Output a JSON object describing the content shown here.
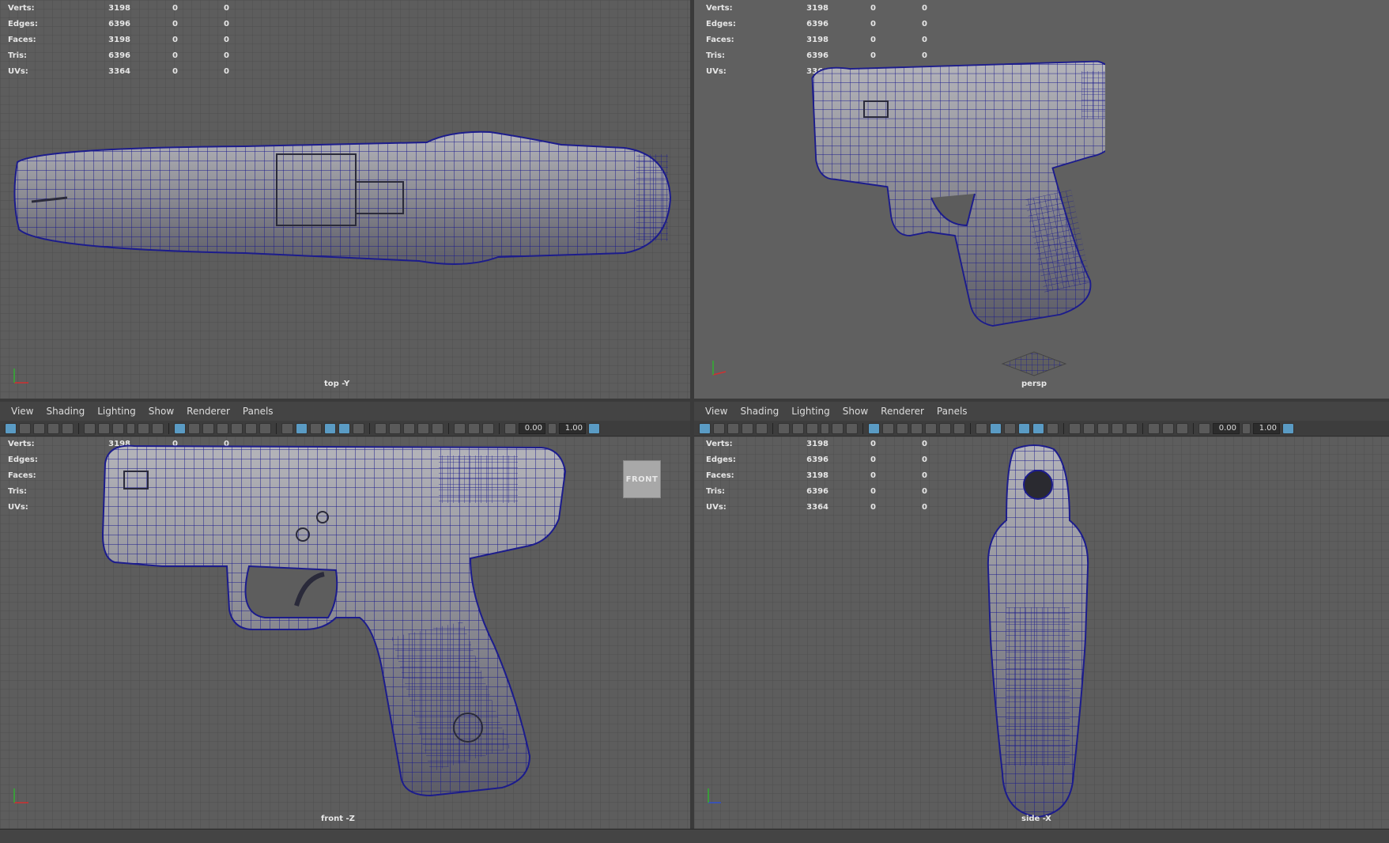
{
  "panel_menu": [
    "View",
    "Shading",
    "Lighting",
    "Show",
    "Renderer",
    "Panels"
  ],
  "toolbar": {
    "near_clip": "0.00",
    "far_clip": "1.00"
  },
  "stats": {
    "rows": [
      {
        "label": "Verts:",
        "v1": "3198",
        "v2": "0",
        "v3": "0"
      },
      {
        "label": "Edges:",
        "v1": "6396",
        "v2": "0",
        "v3": "0"
      },
      {
        "label": "Faces:",
        "v1": "3198",
        "v2": "0",
        "v3": "0"
      },
      {
        "label": "Tris:",
        "v1": "6396",
        "v2": "0",
        "v3": "0"
      },
      {
        "label": "UVs:",
        "v1": "3364",
        "v2": "0",
        "v3": "0"
      }
    ]
  },
  "viewports": {
    "top": {
      "camera": "top -Y"
    },
    "persp": {
      "camera": "persp"
    },
    "front": {
      "camera": "front -Z",
      "view_cube": "FRONT"
    },
    "side": {
      "camera": "side -X"
    }
  },
  "colors": {
    "wire": "#1c1c8c",
    "mesh": "#8e8e94",
    "viewport_bg": "#5d5d5d",
    "accent": "#5a9bc4"
  }
}
